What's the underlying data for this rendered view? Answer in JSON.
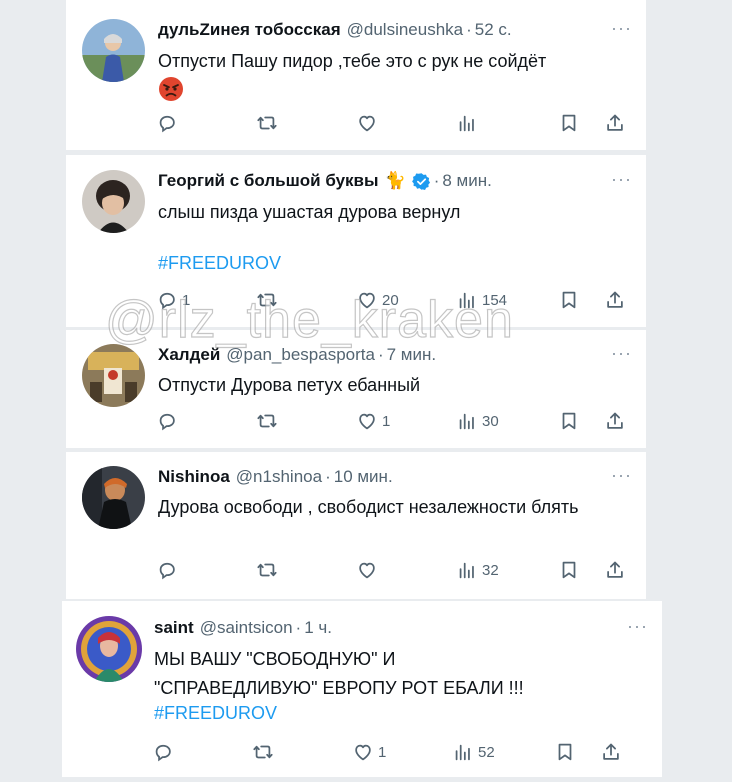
{
  "tweets": [
    {
      "name": "дульZинея тобосская",
      "handle": "@dulsineushka",
      "time": "52 с.",
      "text": "Отпусти Пашу пидор ,тебе это с рук не сойдёт",
      "emoji": "angry-face",
      "hashtag": "",
      "counts": {
        "reply": "",
        "retweet": "",
        "like": "",
        "views": ""
      }
    },
    {
      "name": "Георгий с большой буквы",
      "handle": "",
      "time": "8 мин.",
      "badge_emoji": "🐈",
      "verified": true,
      "text": "слыш пизда ушастая дурова вернул",
      "hashtag": "#FREEDUROV",
      "counts": {
        "reply": "1",
        "retweet": "",
        "like": "20",
        "views": "154"
      }
    },
    {
      "name": "Халдей",
      "handle": "@pan_bespasporta",
      "time": "7 мин.",
      "text": "Отпусти Дурова петух ебанный",
      "hashtag": "",
      "counts": {
        "reply": "",
        "retweet": "",
        "like": "1",
        "views": "30"
      }
    },
    {
      "name": "Nishinoa",
      "handle": "@n1shinoa",
      "time": "10 мин.",
      "text": "Дурова освободи , свободист незалежности блять",
      "hashtag": "",
      "counts": {
        "reply": "",
        "retweet": "",
        "like": "",
        "views": "32"
      }
    },
    {
      "name": "saint",
      "handle": "@saintsicon",
      "time": "1 ч.",
      "text_line1": "МЫ ВАШУ \"СВОБОДНУЮ\" И",
      "text_line2": "\"СПРАВЕДЛИВУЮ\" ЕВРОПУ РОТ ЕБАЛИ !!!",
      "hashtag": "#FREEDUROV",
      "counts": {
        "reply": "",
        "retweet": "",
        "like": "1",
        "views": "52"
      }
    }
  ],
  "watermark": "@rlz_the_kraken",
  "more_glyph": "···",
  "dot": "·",
  "icons": [
    "reply-icon",
    "retweet-icon",
    "like-icon",
    "views-icon",
    "bookmark-icon",
    "share-icon"
  ],
  "colors": {
    "text": "#0f1419",
    "secondary": "#536471",
    "link": "#1d9bf0",
    "verified": "#1d9bf0",
    "background": "#e9ecef"
  }
}
